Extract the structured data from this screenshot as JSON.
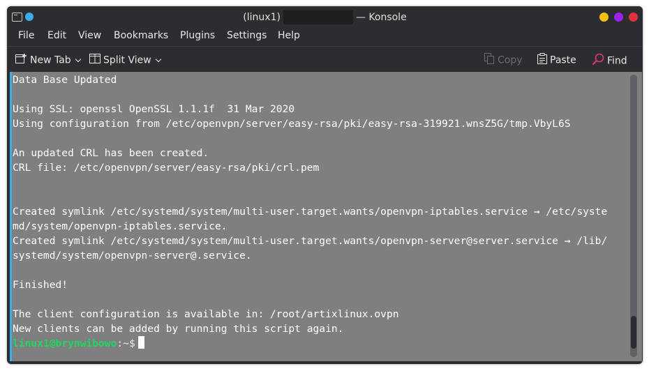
{
  "window": {
    "title_prefix": "(linux1)",
    "title_suffix": "— Konsole"
  },
  "menu": {
    "file": "File",
    "edit": "Edit",
    "view": "View",
    "bookmarks": "Bookmarks",
    "plugins": "Plugins",
    "settings": "Settings",
    "help": "Help"
  },
  "toolbar": {
    "new_tab": "New Tab",
    "split_view": "Split View",
    "copy": "Copy",
    "paste": "Paste",
    "find": "Find"
  },
  "terminal": {
    "lines": [
      "Data Base Updated",
      "",
      "Using SSL: openssl OpenSSL 1.1.1f  31 Mar 2020",
      "Using configuration from /etc/openvpn/server/easy-rsa/pki/easy-rsa-319921.wnsZ5G/tmp.VbyL6S",
      "",
      "An updated CRL has been created.",
      "CRL file: /etc/openvpn/server/easy-rsa/pki/crl.pem",
      "",
      "",
      "Created symlink /etc/systemd/system/multi-user.target.wants/openvpn-iptables.service → /etc/syste",
      "md/system/openvpn-iptables.service.",
      "Created symlink /etc/systemd/system/multi-user.target.wants/openvpn-server@server.service → /lib/",
      "systemd/system/openvpn-server@.service.",
      "",
      "Finished!",
      "",
      "The client configuration is available in: /root/artixlinux.ovpn",
      "New clients can be added by running this script again."
    ],
    "prompt_user": "linux1@brynwibowo",
    "prompt_path": ":~$"
  },
  "colors": {
    "accent": "#3daee9",
    "terminal_bg": "#7f7f7f",
    "prompt_green": "#1ed760",
    "minimize": "#f5c211",
    "maximize": "#a020f0",
    "close": "#e0313c"
  }
}
